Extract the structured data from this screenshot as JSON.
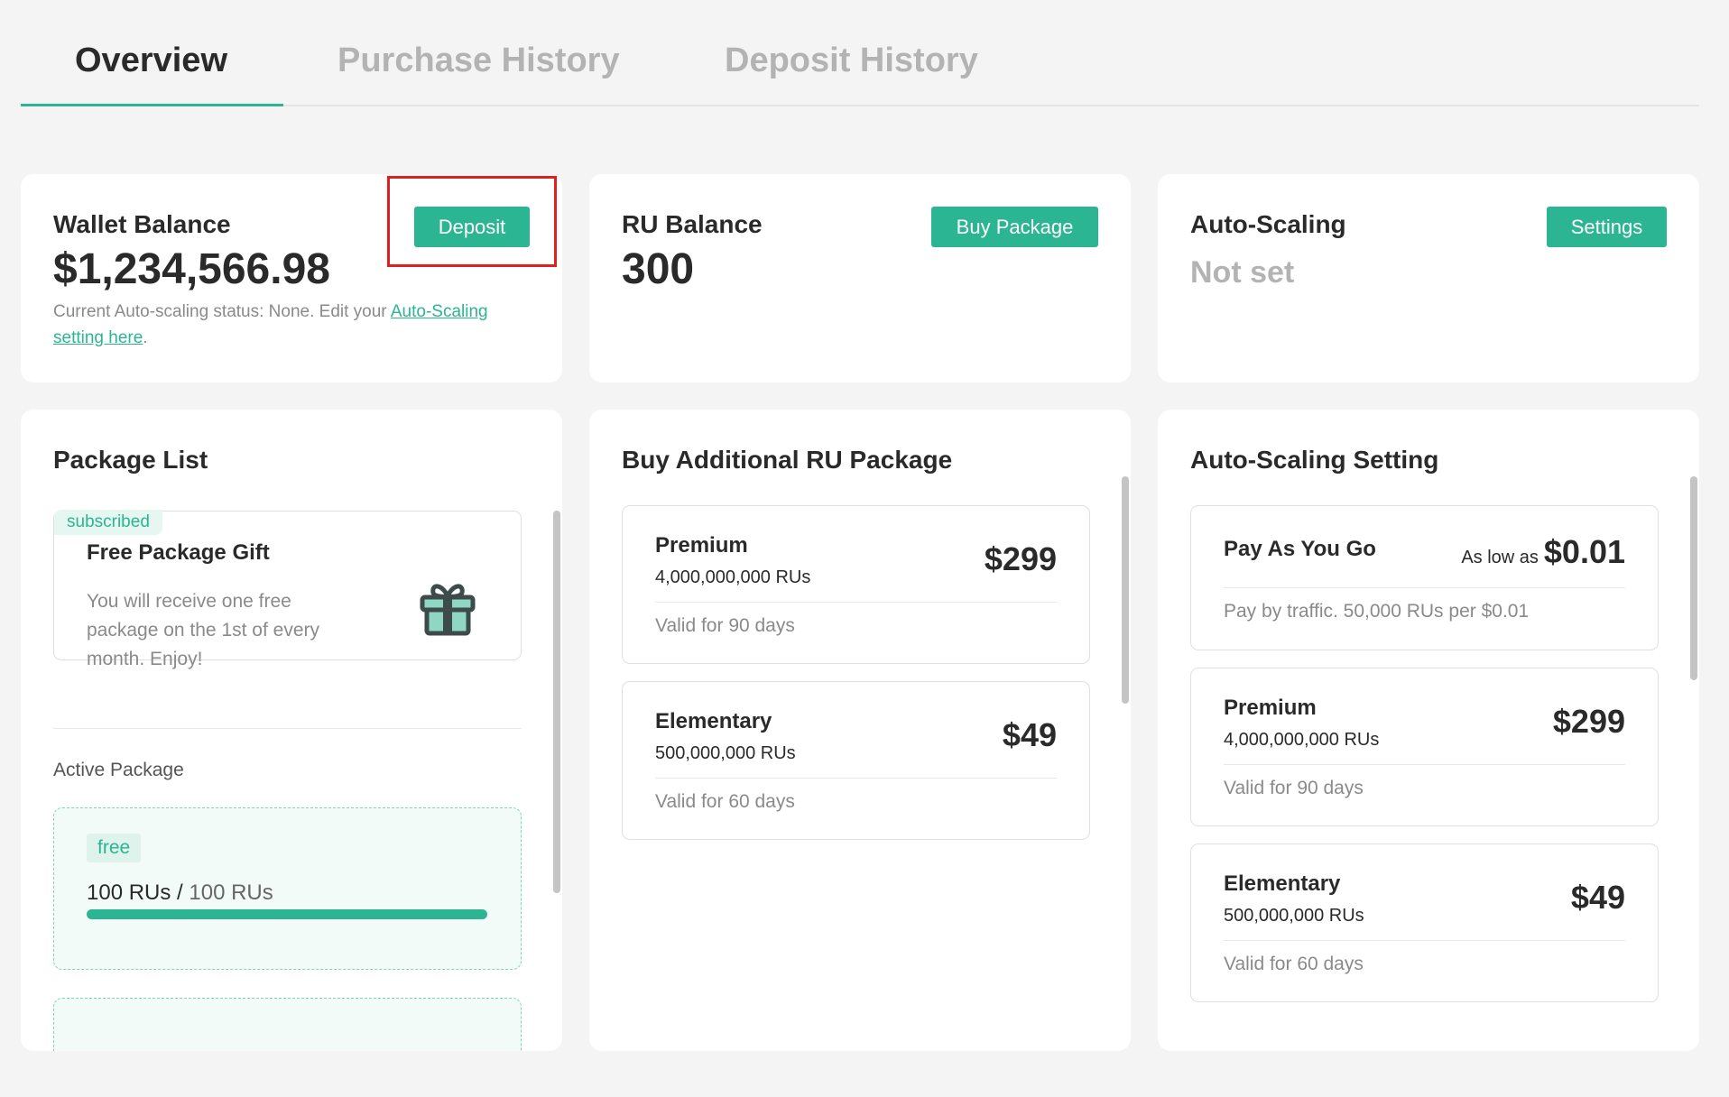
{
  "tabs": [
    {
      "label": "Overview",
      "active": true
    },
    {
      "label": "Purchase History",
      "active": false
    },
    {
      "label": "Deposit History",
      "active": false
    }
  ],
  "wallet": {
    "label": "Wallet Balance",
    "value": "$1,234,566.98",
    "button": "Deposit",
    "status_prefix": "Current Auto-scaling status: None. Edit your ",
    "status_link": "Auto-Scaling setting here",
    "status_suffix": "."
  },
  "ru_balance": {
    "label": "RU Balance",
    "value": "300",
    "button": "Buy Package"
  },
  "auto_scaling": {
    "label": "Auto-Scaling",
    "value": "Not set",
    "button": "Settings"
  },
  "package_list": {
    "title": "Package List",
    "gift": {
      "badge": "subscribed",
      "title": "Free Package Gift",
      "description": "You will receive one free package on the 1st of every month. Enjoy!",
      "icon": "gift-icon"
    },
    "active_label": "Active Package",
    "active": {
      "badge": "free",
      "used": "100 RUs",
      "separator": "/",
      "total": "100 RUs",
      "progress": 1.0
    }
  },
  "buy_additional": {
    "title": "Buy Additional RU Package",
    "packages": [
      {
        "name": "Premium",
        "rus": "4,000,000,000 RUs",
        "price": "$299",
        "valid": "Valid for 90 days"
      },
      {
        "name": "Elementary",
        "rus": "500,000,000 RUs",
        "price": "$49",
        "valid": "Valid for 60 days"
      }
    ]
  },
  "auto_scaling_setting": {
    "title": "Auto-Scaling Setting",
    "pay_as_you_go": {
      "name": "Pay As You Go",
      "low_as": "As low as",
      "price": "$0.01",
      "desc": "Pay by traffic. 50,000 RUs per $0.01"
    },
    "packages": [
      {
        "name": "Premium",
        "rus": "4,000,000,000 RUs",
        "price": "$299",
        "valid": "Valid for 90 days"
      },
      {
        "name": "Elementary",
        "rus": "500,000,000 RUs",
        "price": "$49",
        "valid": "Valid for 60 days"
      }
    ]
  },
  "colors": {
    "accent": "#2cb592",
    "highlight": "#e02020",
    "background": "#f4f4f4"
  }
}
